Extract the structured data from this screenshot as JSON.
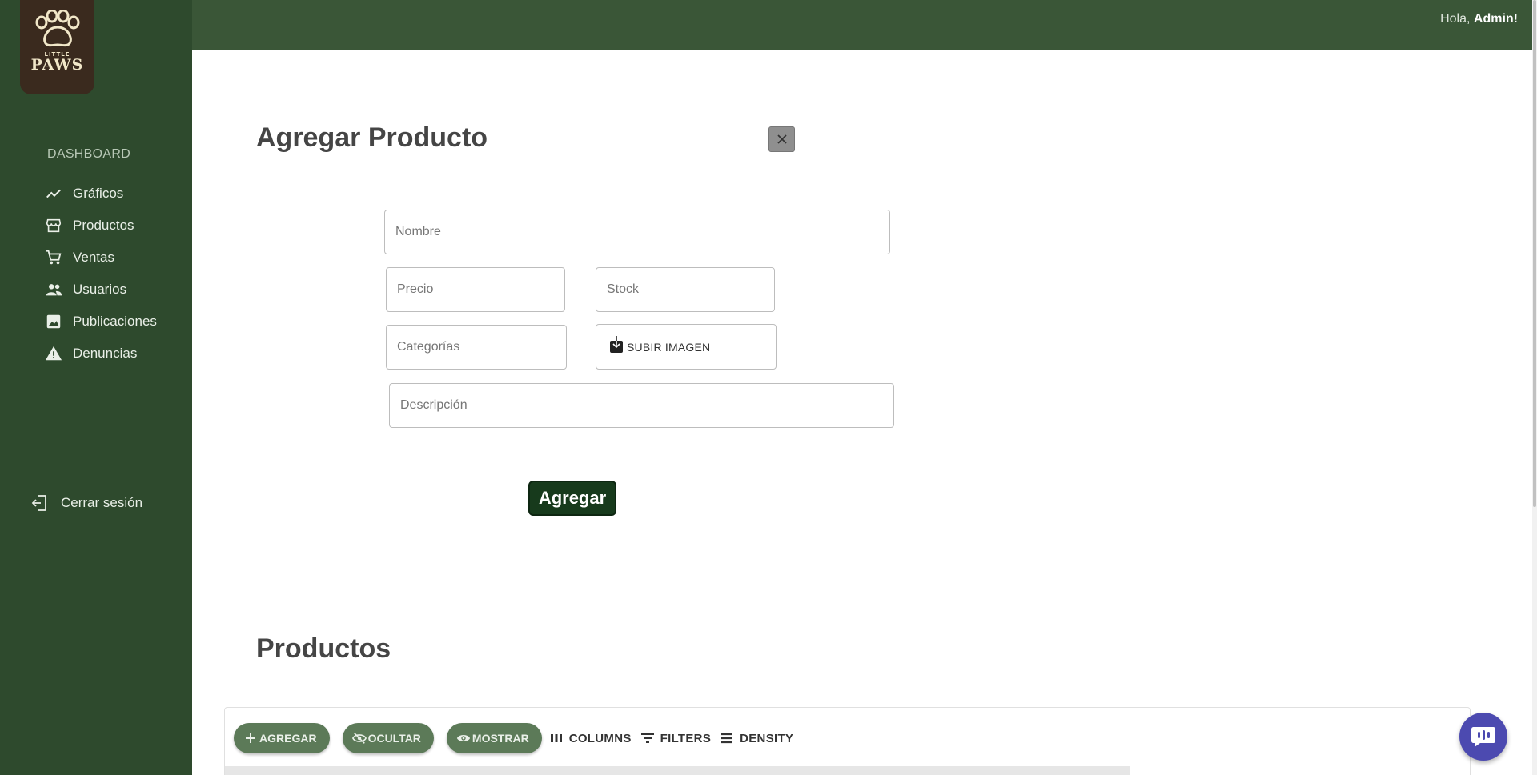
{
  "brand": {
    "small": "LITTLE",
    "big": "PAWS"
  },
  "topbar": {
    "greeting_prefix": "Hola,",
    "user": "Admin!"
  },
  "sidebar": {
    "heading": "DASHBOARD",
    "items": [
      {
        "label": "Gráficos",
        "icon": "chart-line-icon"
      },
      {
        "label": "Productos",
        "icon": "store-icon"
      },
      {
        "label": "Ventas",
        "icon": "cart-icon"
      },
      {
        "label": "Usuarios",
        "icon": "people-icon"
      },
      {
        "label": "Publicaciones",
        "icon": "image-icon"
      },
      {
        "label": "Denuncias",
        "icon": "warning-icon"
      }
    ],
    "logout": "Cerrar sesión"
  },
  "form": {
    "title": "Agregar Producto",
    "close_symbol": "✕",
    "nombre_placeholder": "Nombre",
    "precio_placeholder": "Precio",
    "stock_placeholder": "Stock",
    "categorias_placeholder": "Categorías",
    "upload_label": "SUBIR IMAGEN",
    "descripcion_placeholder": "Descripción",
    "submit_label": "Agregar"
  },
  "products": {
    "title": "Productos",
    "toolbar": {
      "agregar": "AGREGAR",
      "ocultar": "OCULTAR",
      "mostrar": "MOSTRAR",
      "columns": "COLUMNS",
      "filters": "FILTERS",
      "density": "DENSITY"
    }
  },
  "colors": {
    "sidebar_bg": "#2e4a2d",
    "topbar_bg": "#3a5637",
    "submit_bg": "#173a1c",
    "pill_bg": "#5c7a58",
    "chat_bg": "#4c4ab0"
  }
}
